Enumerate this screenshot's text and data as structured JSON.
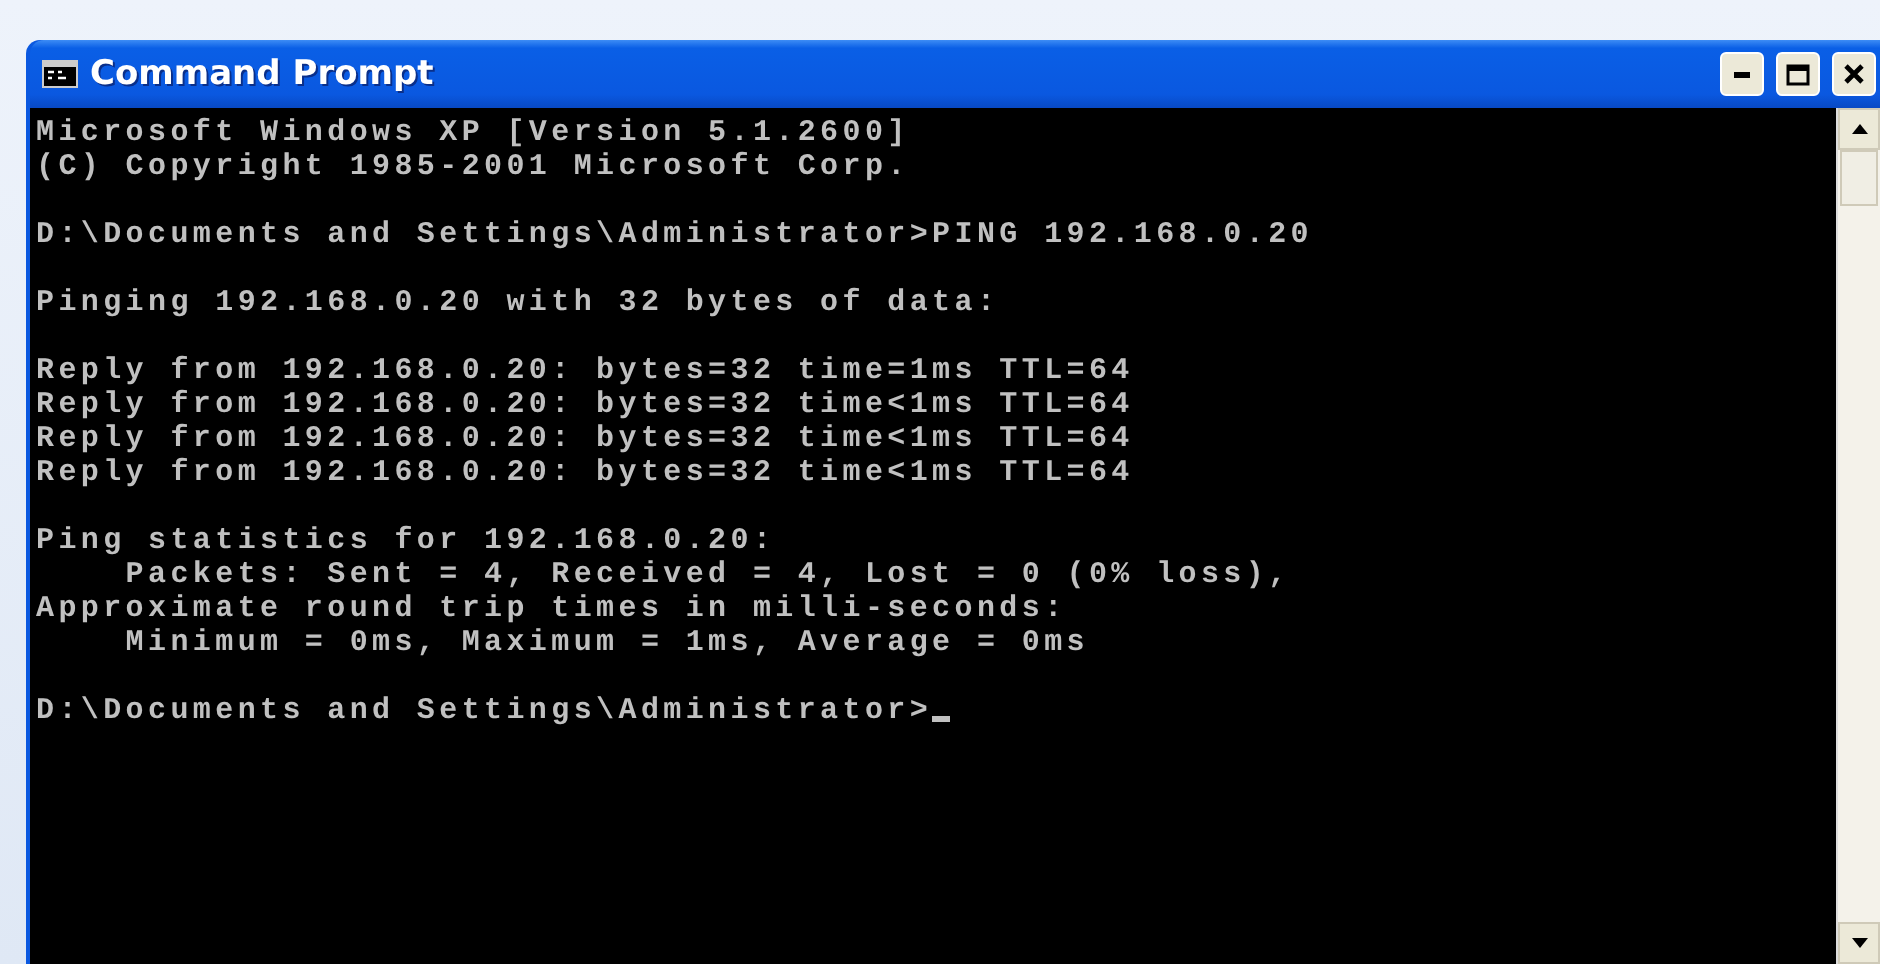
{
  "window": {
    "title": "Command Prompt"
  },
  "console": {
    "blocks": [
      [
        "Microsoft Windows XP [Version 5.1.2600]",
        "(C) Copyright 1985-2001 Microsoft Corp."
      ],
      [
        "D:\\Documents and Settings\\Administrator>PING 192.168.0.20"
      ],
      [
        "Pinging 192.168.0.20 with 32 bytes of data:"
      ],
      [
        "Reply from 192.168.0.20: bytes=32 time=1ms TTL=64",
        "Reply from 192.168.0.20: bytes=32 time<1ms TTL=64",
        "Reply from 192.168.0.20: bytes=32 time<1ms TTL=64",
        "Reply from 192.168.0.20: bytes=32 time<1ms TTL=64"
      ],
      [
        "Ping statistics for 192.168.0.20:",
        "    Packets: Sent = 4, Received = 4, Lost = 0 (0% loss),",
        "Approximate round trip times in milli-seconds:",
        "    Minimum = 0ms, Maximum = 1ms, Average = 0ms"
      ],
      [
        "D:\\Documents and Settings\\Administrator>"
      ]
    ],
    "cursor": true
  }
}
